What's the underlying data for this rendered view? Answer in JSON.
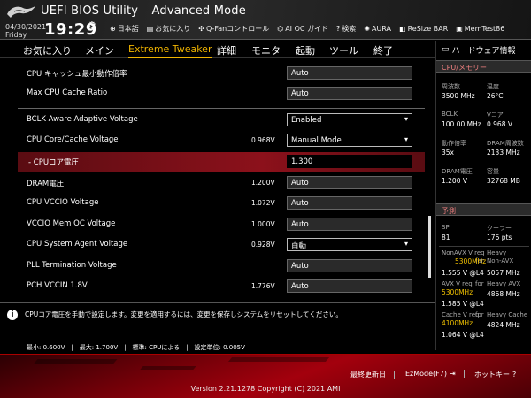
{
  "header": {
    "title": "UEFI BIOS Utility – Advanced Mode",
    "date": "04/30/2021",
    "day": "Friday",
    "time": "19:29",
    "toolbar": [
      {
        "label": "日本語",
        "icon": "globe-icon"
      },
      {
        "label": "お気に入り",
        "icon": "favorites-icon"
      },
      {
        "label": "Q-Fanコントロール",
        "icon": "fan-icon"
      },
      {
        "label": "AI OC ガイド",
        "icon": "ai-icon"
      },
      {
        "label": "検索",
        "icon": "help-icon"
      },
      {
        "label": "AURA",
        "icon": "aura-icon"
      },
      {
        "label": "ReSize BAR",
        "icon": "resize-bar-icon"
      },
      {
        "label": "MemTest86",
        "icon": "memtest-icon"
      }
    ]
  },
  "nav": {
    "tabs": [
      "お気に入り",
      "メイン",
      "Extreme Tweaker",
      "詳細",
      "モニタ",
      "起動",
      "ツール",
      "終了"
    ],
    "active": "Extreme Tweaker"
  },
  "settings": [
    {
      "label": "CPU キャッシュ最小動作倍率",
      "current": "",
      "value": "Auto",
      "type": "text"
    },
    {
      "label": "Max CPU Cache Ratio",
      "current": "",
      "value": "Auto",
      "type": "text"
    },
    {
      "label": "BCLK Aware Adaptive Voltage",
      "current": "",
      "value": "Enabled",
      "type": "select"
    },
    {
      "label": "CPU Core/Cache Voltage",
      "current": "0.968V",
      "value": "Manual Mode",
      "type": "select"
    },
    {
      "label": "- CPUコア電圧",
      "current": "",
      "value": "1.300",
      "type": "text",
      "highlight": true
    },
    {
      "label": "DRAM電圧",
      "current": "1.200V",
      "value": "Auto",
      "type": "text"
    },
    {
      "label": "CPU VCCIO Voltage",
      "current": "1.072V",
      "value": "Auto",
      "type": "text"
    },
    {
      "label": "VCCIO Mem OC Voltage",
      "current": "1.000V",
      "value": "Auto",
      "type": "text"
    },
    {
      "label": "CPU System Agent Voltage",
      "current": "0.928V",
      "value": "自動",
      "type": "select"
    },
    {
      "label": "PLL Termination Voltage",
      "current": "",
      "value": "Auto",
      "type": "text"
    },
    {
      "label": "PCH VCCIN 1.8V",
      "current": "1.776V",
      "value": "Auto",
      "type": "text"
    }
  ],
  "help": {
    "text": "CPUコア電圧を手動で設定します。変更を適用するには、変更を保存しシステムをリセットしてください。",
    "range": "最小: 0.600V　|　最大: 1.700V　|　標準: CPUによる　|　設定単位: 0.005V"
  },
  "hw_monitor": {
    "title": "ハードウェア情報",
    "cpu_section": "CPU/メモリー",
    "cpu": [
      {
        "k": "周波数",
        "v": "3500 MHz"
      },
      {
        "k": "温度",
        "v": "26°C"
      },
      {
        "k": "BCLK",
        "v": "100.00 MHz"
      },
      {
        "k": "Vコア",
        "v": "0.968 V"
      },
      {
        "k": "動作倍率",
        "v": "35x"
      },
      {
        "k": "DRAM周波数",
        "v": "2133 MHz"
      },
      {
        "k": "DRAM電圧",
        "v": "1.200 V"
      },
      {
        "k": "容量",
        "v": "32768 MB"
      }
    ],
    "predict_section": "予測",
    "sp_k": "SP",
    "sp_v": "81",
    "cooler_k": "クーラー",
    "cooler_v": "176 pts",
    "nonavx_k1": "NonAVX V req",
    "nonavx_k2": "for",
    "nonavx_freq": "5300MHz",
    "nonavx_v": "1.555 V @L4",
    "heavy_nonavx_k1": "Heavy",
    "heavy_nonavx_k2": "Non-AVX",
    "heavy_nonavx_v": "5057 MHz",
    "avx_k1": "AVX V req",
    "avx_k2": "for",
    "avx_freq": "5300MHz",
    "avx_v": "1.585 V @L4",
    "heavy_avx_k": "Heavy AVX",
    "heavy_avx_v": "4868 MHz",
    "cache_k1": "Cache V req",
    "cache_k2": "for",
    "cache_freq": "4100MHz",
    "cache_v": "1.064 V @L4",
    "heavy_cache_k": "Heavy Cache",
    "heavy_cache_v": "4824 MHz"
  },
  "footer": {
    "last_modified": "最終更新日",
    "ezmode": "EzMode(F7)",
    "hotkey": "ホットキー",
    "version": "Version 2.21.1278 Copyright (C) 2021 AMI"
  },
  "colors": {
    "accent": "#f0b400",
    "highlight": "#8c111b",
    "hw_section": "#f08080"
  }
}
